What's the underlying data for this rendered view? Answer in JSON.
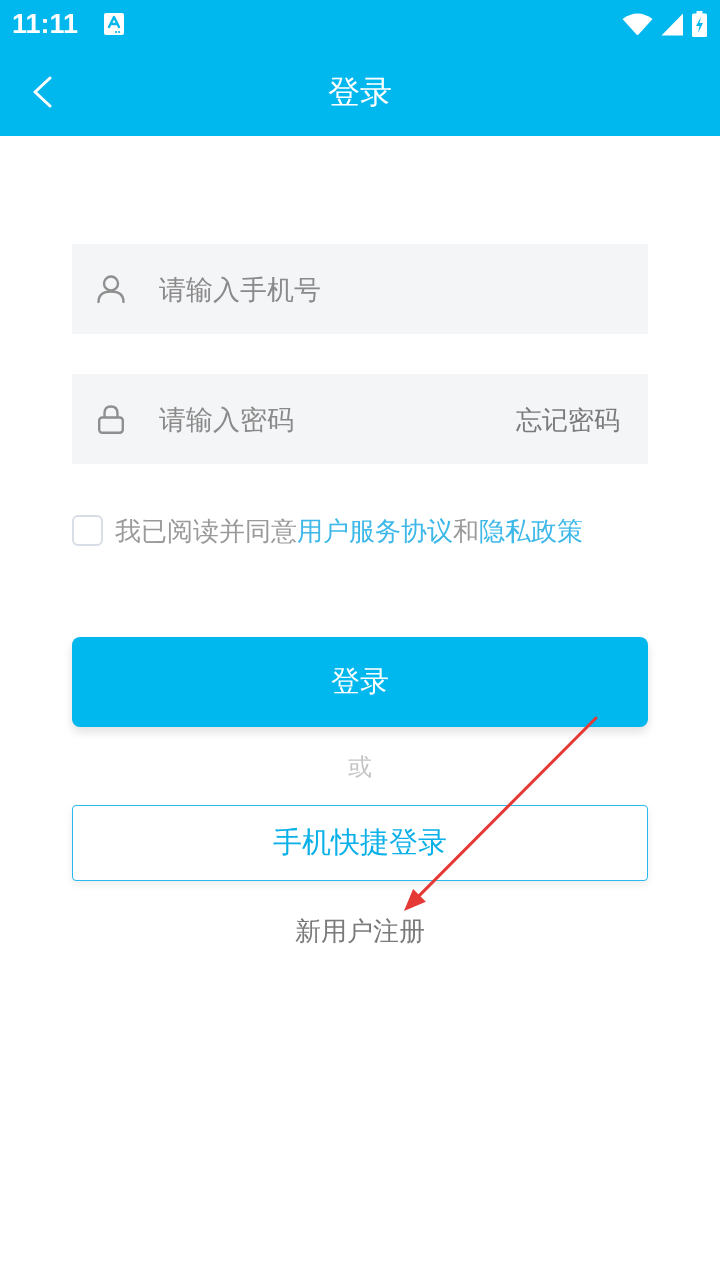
{
  "status_bar": {
    "time": "11:11"
  },
  "app_bar": {
    "title": "登录"
  },
  "phone_field": {
    "placeholder": "请输入手机号"
  },
  "password_field": {
    "placeholder": "请输入密码",
    "forgot_link": "忘记密码"
  },
  "agreement": {
    "checked": false,
    "parts": [
      {
        "kind": "text",
        "text": "我已阅读并同意"
      },
      {
        "kind": "link",
        "text": "用户服务协议"
      },
      {
        "kind": "text",
        "text": "和"
      },
      {
        "kind": "link",
        "text": "隐私政策"
      }
    ]
  },
  "login_button": "登录",
  "separator": "或",
  "quick_login_button": "手机快捷登录",
  "register_link": "新用户注册",
  "annotations": [
    {
      "kind": "arrow"
    }
  ]
}
